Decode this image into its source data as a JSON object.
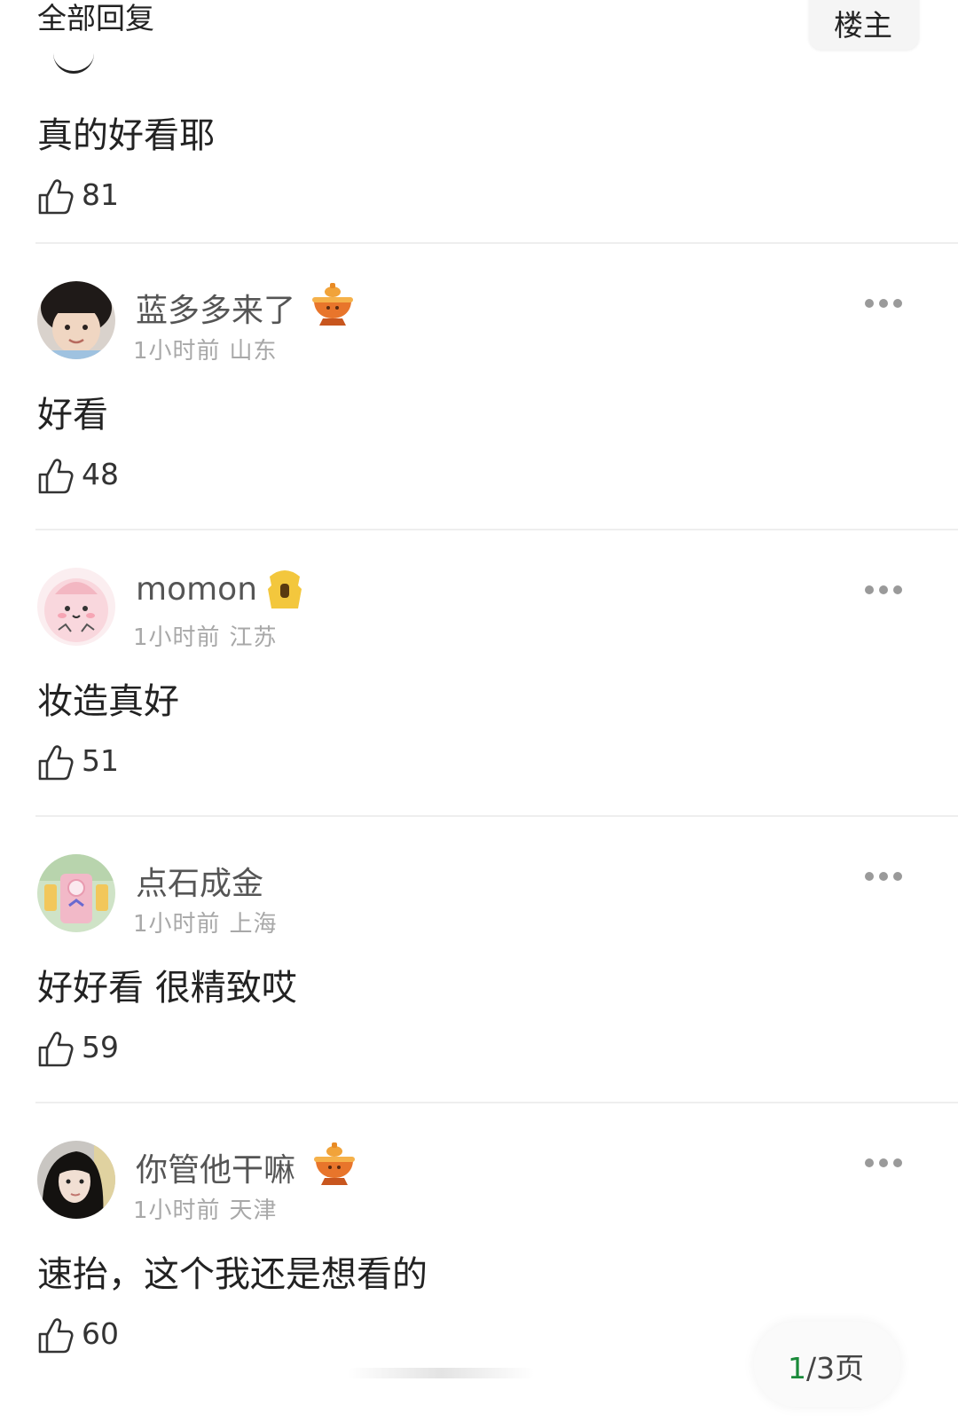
{
  "header": {
    "title": "全部回复",
    "op_label": "楼主"
  },
  "first_comment": {
    "text": "真的好看耶",
    "likes": "81"
  },
  "comments": [
    {
      "user": "蓝多多来了",
      "time": "1小时前",
      "location": "山东",
      "text": "好看",
      "likes": "48",
      "badge": "hotpot-badge-icon"
    },
    {
      "user": "momon",
      "time": "1小时前",
      "location": "江苏",
      "text": "妆造真好",
      "likes": "51",
      "badge": "toast-badge-icon"
    },
    {
      "user": "点石成金",
      "time": "1小时前",
      "location": "上海",
      "text": "好好看 很精致哎",
      "likes": "59"
    },
    {
      "user": "你管他干嘛",
      "time": "1小时前",
      "location": "天津",
      "text": "速抬，这个我还是想看的",
      "likes": "60",
      "badge": "hotpot-badge-icon"
    }
  ],
  "pager": {
    "current": "1",
    "total_text": "/3页"
  },
  "colors": {
    "page_current": "#1a8a3a",
    "meta_text": "#a8a8a8",
    "divider": "#eeeeee"
  }
}
